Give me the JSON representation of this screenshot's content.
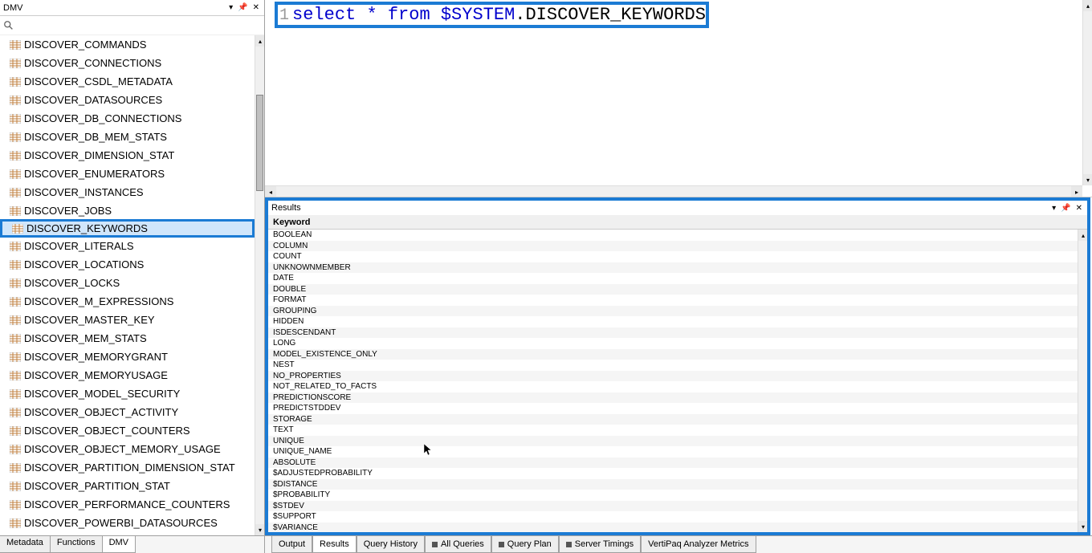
{
  "left_panel": {
    "title": "DMV",
    "search_placeholder": "",
    "items": [
      {
        "label": "DISCOVER_COMMANDS",
        "selected": false
      },
      {
        "label": "DISCOVER_CONNECTIONS",
        "selected": false
      },
      {
        "label": "DISCOVER_CSDL_METADATA",
        "selected": false
      },
      {
        "label": "DISCOVER_DATASOURCES",
        "selected": false
      },
      {
        "label": "DISCOVER_DB_CONNECTIONS",
        "selected": false
      },
      {
        "label": "DISCOVER_DB_MEM_STATS",
        "selected": false
      },
      {
        "label": "DISCOVER_DIMENSION_STAT",
        "selected": false
      },
      {
        "label": "DISCOVER_ENUMERATORS",
        "selected": false
      },
      {
        "label": "DISCOVER_INSTANCES",
        "selected": false
      },
      {
        "label": "DISCOVER_JOBS",
        "selected": false
      },
      {
        "label": "DISCOVER_KEYWORDS",
        "selected": true
      },
      {
        "label": "DISCOVER_LITERALS",
        "selected": false
      },
      {
        "label": "DISCOVER_LOCATIONS",
        "selected": false
      },
      {
        "label": "DISCOVER_LOCKS",
        "selected": false
      },
      {
        "label": "DISCOVER_M_EXPRESSIONS",
        "selected": false
      },
      {
        "label": "DISCOVER_MASTER_KEY",
        "selected": false
      },
      {
        "label": "DISCOVER_MEM_STATS",
        "selected": false
      },
      {
        "label": "DISCOVER_MEMORYGRANT",
        "selected": false
      },
      {
        "label": "DISCOVER_MEMORYUSAGE",
        "selected": false
      },
      {
        "label": "DISCOVER_MODEL_SECURITY",
        "selected": false
      },
      {
        "label": "DISCOVER_OBJECT_ACTIVITY",
        "selected": false
      },
      {
        "label": "DISCOVER_OBJECT_COUNTERS",
        "selected": false
      },
      {
        "label": "DISCOVER_OBJECT_MEMORY_USAGE",
        "selected": false
      },
      {
        "label": "DISCOVER_PARTITION_DIMENSION_STAT",
        "selected": false
      },
      {
        "label": "DISCOVER_PARTITION_STAT",
        "selected": false
      },
      {
        "label": "DISCOVER_PERFORMANCE_COUNTERS",
        "selected": false
      },
      {
        "label": "DISCOVER_POWERBI_DATASOURCES",
        "selected": false
      }
    ],
    "tabs": [
      {
        "label": "Metadata",
        "active": false
      },
      {
        "label": "Functions",
        "active": false
      },
      {
        "label": "DMV",
        "active": true
      }
    ]
  },
  "editor": {
    "line_number": "1",
    "tokens": [
      {
        "text": "select",
        "cls": "kw"
      },
      {
        "text": " ",
        "cls": "plain"
      },
      {
        "text": "*",
        "cls": "op"
      },
      {
        "text": " ",
        "cls": "plain"
      },
      {
        "text": "from",
        "cls": "kw"
      },
      {
        "text": " ",
        "cls": "plain"
      },
      {
        "text": "$SYSTEM",
        "cls": "ident"
      },
      {
        "text": ".DISCOVER_KEYWORDS",
        "cls": "plain"
      }
    ],
    "zoom": "347 %"
  },
  "results": {
    "title": "Results",
    "column_header": "Keyword",
    "rows": [
      "BOOLEAN",
      "COLUMN",
      "COUNT",
      "UNKNOWNMEMBER",
      "DATE",
      "DOUBLE",
      "FORMAT",
      "GROUPING",
      "HIDDEN",
      "ISDESCENDANT",
      "LONG",
      "MODEL_EXISTENCE_ONLY",
      "NEST",
      "NO_PROPERTIES",
      "NOT_RELATED_TO_FACTS",
      "PREDICTIONSCORE",
      "PREDICTSTDDEV",
      "STORAGE",
      "TEXT",
      "UNIQUE",
      "UNIQUE_NAME",
      "ABSOLUTE",
      "$ADJUSTEDPROBABILITY",
      "$DISTANCE",
      "$PROBABILITY",
      "$STDEV",
      "$SUPPORT",
      "$VARIANCE"
    ]
  },
  "bottom_tabs": [
    {
      "label": "Output",
      "active": false,
      "stop": false
    },
    {
      "label": "Results",
      "active": true,
      "stop": false
    },
    {
      "label": "Query History",
      "active": false,
      "stop": false
    },
    {
      "label": "All Queries",
      "active": false,
      "stop": true
    },
    {
      "label": "Query Plan",
      "active": false,
      "stop": true
    },
    {
      "label": "Server Timings",
      "active": false,
      "stop": true
    },
    {
      "label": "VertiPaq Analyzer Metrics",
      "active": false,
      "stop": false
    }
  ]
}
